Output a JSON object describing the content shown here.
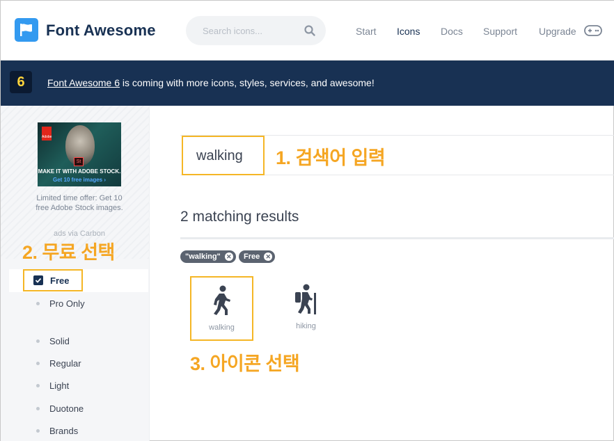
{
  "header": {
    "logo_text": "Font Awesome",
    "search_placeholder": "Search icons...",
    "nav": [
      "Start",
      "Icons",
      "Docs",
      "Support",
      "Upgrade"
    ]
  },
  "banner": {
    "badge": "6",
    "link": "Font Awesome 6",
    "text": " is coming with more icons, styles, services, and awesome!"
  },
  "sidebar": {
    "ad": {
      "line1": "MAKE IT WITH ADOBE STOCK.",
      "line2": "Get 10 free images ›",
      "brand": "Adobe",
      "st": "St",
      "caption": "Limited time offer: Get 10 free Adobe Stock images.",
      "via": "ads via Carbon"
    },
    "annotation": "2. 무료 선택",
    "license_filters": [
      "Free",
      "Pro Only"
    ],
    "style_filters": [
      "Solid",
      "Regular",
      "Light",
      "Duotone",
      "Brands"
    ]
  },
  "main": {
    "query": "walking",
    "annotation1": "1. 검색어 입력",
    "results_text": "2 matching results",
    "chips": [
      "\"walking\"",
      "Free"
    ],
    "chip_close": "✕",
    "icons": [
      {
        "label": "walking",
        "icon": "walking-icon"
      },
      {
        "label": "hiking",
        "icon": "hiking-icon"
      }
    ],
    "annotation3": "3. 아이콘 선택"
  },
  "colors": {
    "navy": "#183153",
    "accent": "#f5b625",
    "brand_blue": "#339af0"
  }
}
